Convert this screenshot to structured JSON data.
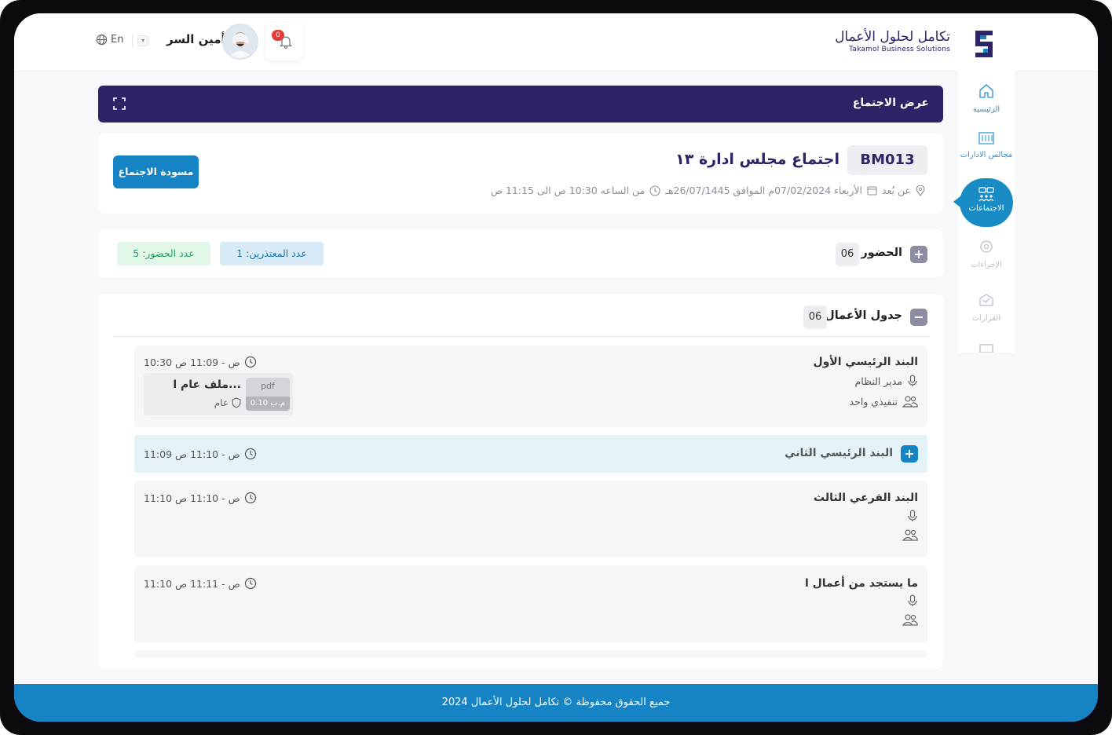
{
  "header": {
    "brand_ar": "تكامل لحلول الأعمال",
    "brand_en": "Takamol Business Solutions",
    "lang": "En",
    "username": "أمين السر",
    "notifications": "0"
  },
  "sidebar": {
    "items": [
      {
        "label": "الرئيسية",
        "icon": "home-icon"
      },
      {
        "label": "مجالس الادارات",
        "icon": "boards-icon"
      },
      {
        "label": "الاجتماعات",
        "icon": "meetings-icon",
        "active": true
      },
      {
        "label": "الإجراءات",
        "icon": "procedures-icon"
      },
      {
        "label": "القرارات",
        "icon": "decisions-icon"
      }
    ]
  },
  "page": {
    "title": "عرض الاجتماع"
  },
  "meeting": {
    "code": "BM013",
    "title": "اجتماع مجلس ادارة ١٣",
    "location": "عن بُعد",
    "date": "الأربعاء 07/02/2024م الموافق 26/07/1445هـ",
    "time": "من الساعه 10:30 ص الى 11:15 ص",
    "draft_label": "مسودة الاجتماع"
  },
  "attendance": {
    "title": "الحضور",
    "count": "06",
    "excused_label": "عدد المعتذرين: 1",
    "present_label": "عدد الحضور: 5"
  },
  "agenda": {
    "title": "جدول الأعمال",
    "count": "06",
    "items": [
      {
        "title": "البند الرئيسي الأول",
        "time": "10:30 ص - 11:09 ص",
        "speaker": "مدير النظام",
        "group": "تنفيذي واحد",
        "file_title": "ملف عام ا...",
        "file_visibility": "عام",
        "file_type": "pdf",
        "file_size": "0.10 م.ب"
      },
      {
        "title": "البند الرئيسي الثاني",
        "time": "11:09 ص - 11:10 ص"
      },
      {
        "title": "البند الفرعي الثالث",
        "time": "11:10 ص - 11:10 ص"
      },
      {
        "title": "ما يستجد من أعمال ا",
        "time": "11:10 ص - 11:11 ص"
      }
    ]
  },
  "footer": {
    "text": "جميع الحقوق محفوظة © تكامل لحلول الأعمال 2024"
  },
  "colors": {
    "primary": "#2b2466",
    "accent": "#1683c4",
    "excused_bg": "#d6ebf5",
    "present_bg": "#e2f6ea"
  }
}
